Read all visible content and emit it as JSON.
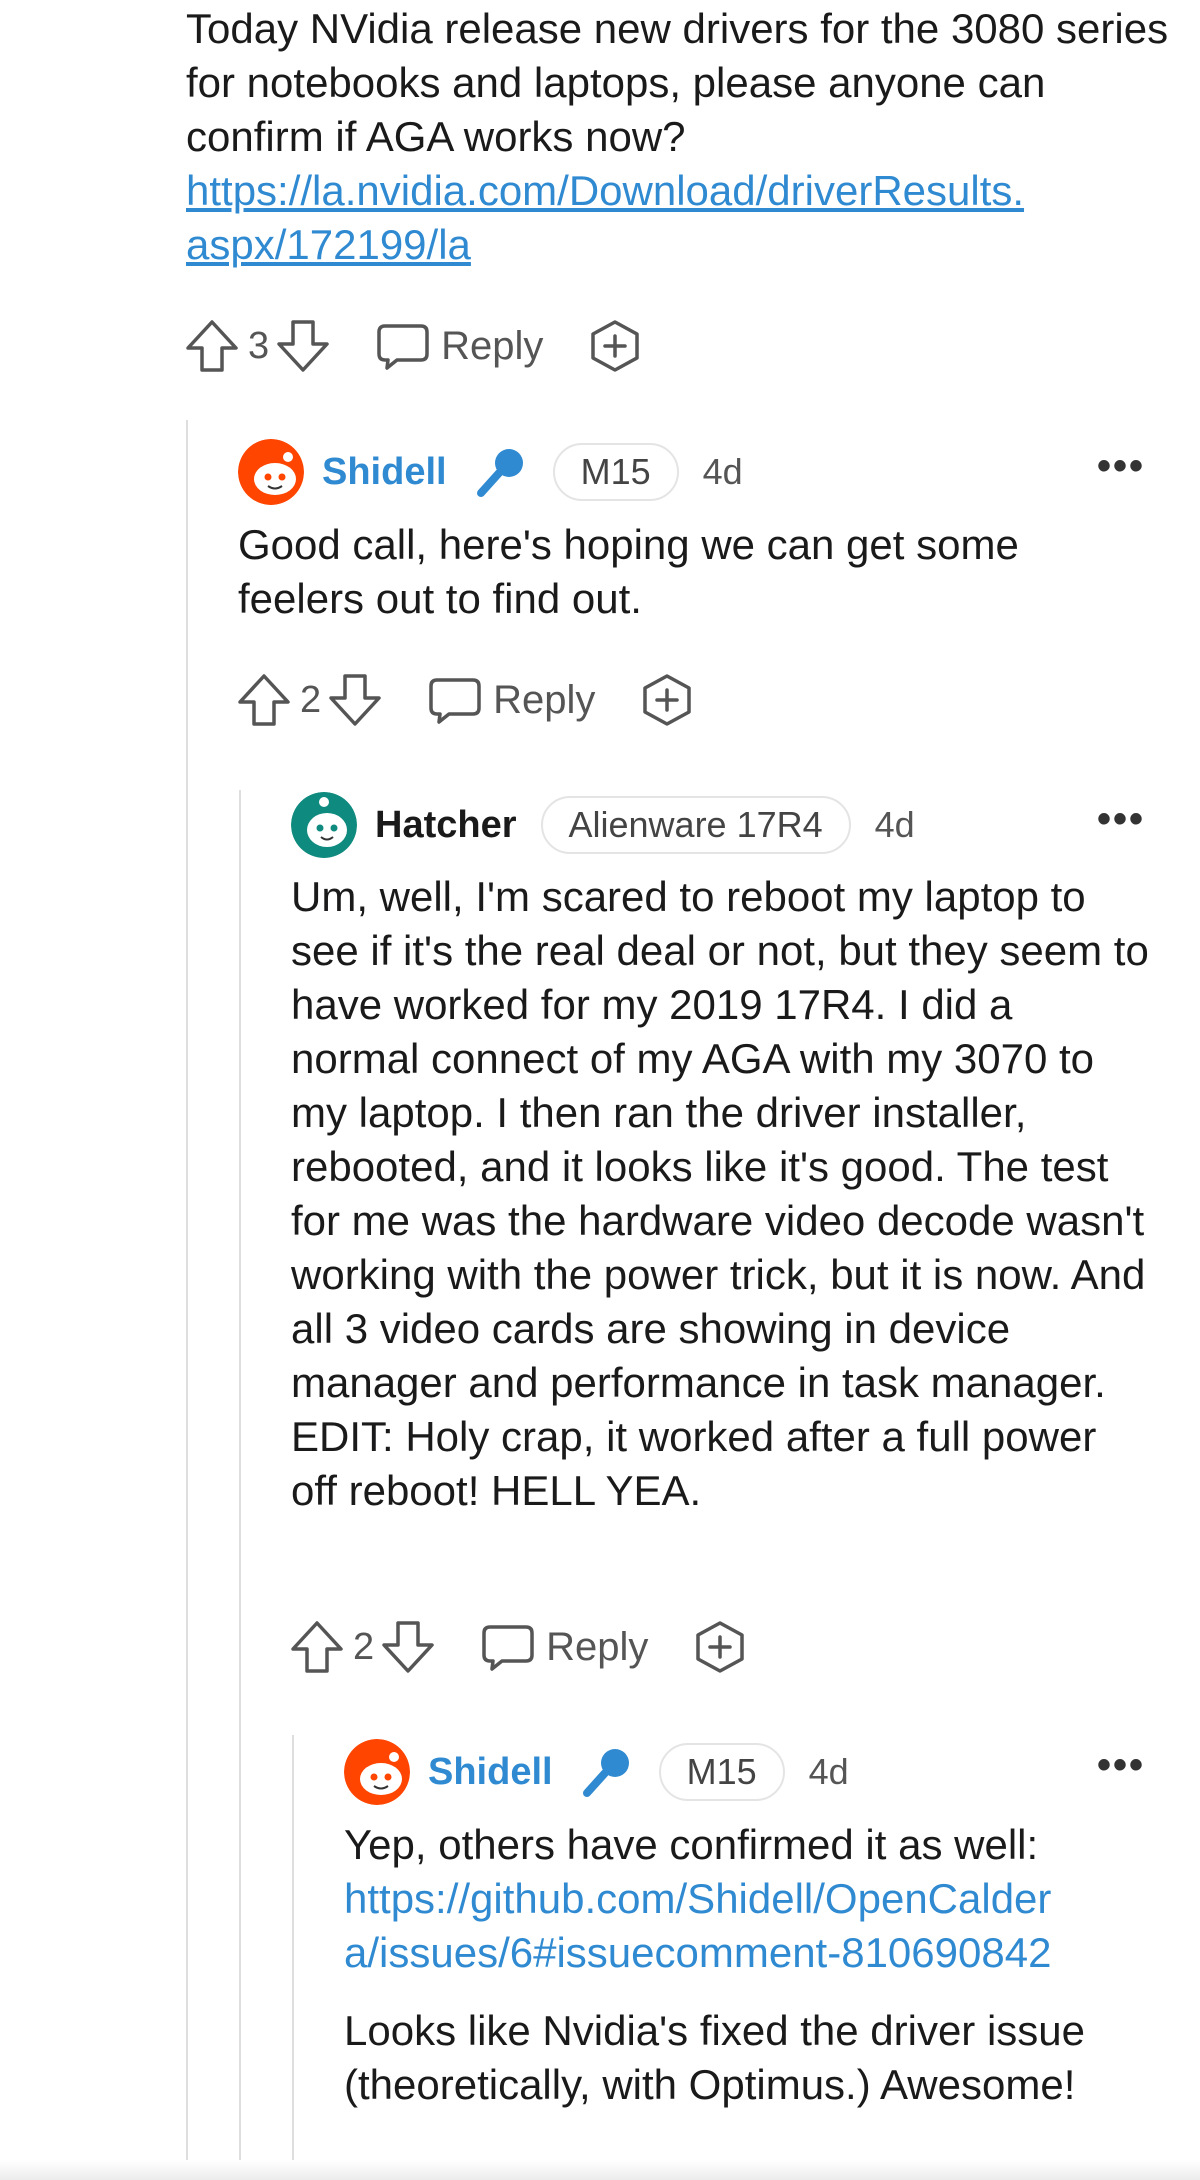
{
  "colors": {
    "accent": "#2f8ad1",
    "text": "#1a1a1b",
    "meta": "#555555",
    "thread_line": "#dedede"
  },
  "top_comment": {
    "text": "Today NVidia release new drivers for the 3080 series for notebooks and laptops, please anyone can confirm if AGA works now?",
    "link_line1": "https://la.nvidia.com/Download/driverResults.",
    "link_line2": "aspx/172199/la",
    "votes": "3",
    "reply_label": "Reply"
  },
  "reply1": {
    "username": "Shidell",
    "flair": "M15",
    "age": "4d",
    "more": "•••",
    "text": "Good call, here's hoping we can get some feelers out to find out.",
    "votes": "2",
    "reply_label": "Reply"
  },
  "reply2": {
    "username": "Hatcher",
    "flair": "Alienware 17R4",
    "age": "4d",
    "more": "•••",
    "text": "Um, well, I'm scared to reboot my laptop to see if it's the real deal or not, but they seem to have worked for my 2019 17R4. I did a normal connect of my AGA with my 3070 to my laptop. I then ran the driver installer, rebooted, and it looks like it's good. The test for me was the hardware video decode wasn't working with the power trick, but it is now. And all 3 video cards are showing in device manager and performance in task manager. EDIT: Holy crap, it worked after a full power off reboot! HELL YEA.",
    "votes": "2",
    "reply_label": "Reply"
  },
  "reply3": {
    "username": "Shidell",
    "flair": "M15",
    "age": "4d",
    "more": "•••",
    "text1": "Yep, others have confirmed it as well:",
    "link_line1": "https://github.com/Shidell/OpenCalder",
    "link_line2": "a/issues/6#issuecomment-810690842",
    "text2": "Looks like Nvidia's fixed the driver issue (theoretically, with Optimus.) Awesome!"
  },
  "icons": [
    "upvote-icon",
    "downvote-icon",
    "comment-bubble-icon",
    "award-icon",
    "moderator-mic-icon",
    "snoo-avatar-icon",
    "more-options-icon"
  ]
}
